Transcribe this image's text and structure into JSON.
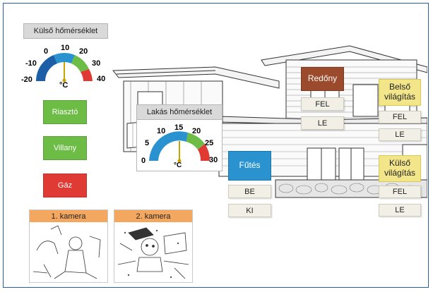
{
  "outside_temp": {
    "title": "Külső hőmérséklet",
    "ticks": [
      "-20",
      "-10",
      "0",
      "10",
      "20",
      "30",
      "40"
    ],
    "unit": "°C",
    "value": 10
  },
  "flat_temp": {
    "title": "Lakás hőmérséklet",
    "ticks": [
      "0",
      "5",
      "10",
      "15",
      "20",
      "25",
      "30"
    ],
    "unit": "°C",
    "value": 15
  },
  "status": {
    "alarm": "Riasztó",
    "power": "Villany",
    "gas": "Gáz"
  },
  "colors": {
    "ok": "#6cbc45",
    "alarm": "#e03a35",
    "shutter": "#9b4a2c",
    "heating": "#2a93cf",
    "lighting": "#f3e68a",
    "camera": "#f4a75e"
  },
  "shutter": {
    "title": "Redőny",
    "up": "FEL",
    "down": "LE"
  },
  "heating": {
    "title": "Fűtés",
    "on": "BE",
    "off": "KI"
  },
  "inside_light": {
    "title": "Belső világítás",
    "up": "FEL",
    "down": "LE"
  },
  "outside_light": {
    "title": "Külső világítás",
    "up": "FEL",
    "down": "LE"
  },
  "cameras": [
    {
      "title": "1. kamera"
    },
    {
      "title": "2. kamera"
    }
  ]
}
